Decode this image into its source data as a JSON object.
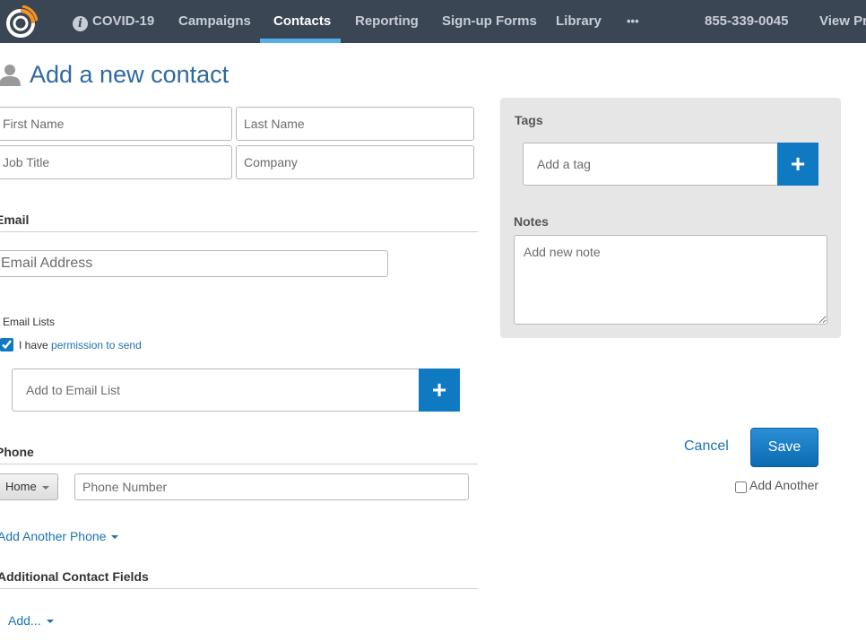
{
  "nav": {
    "items": [
      {
        "label": "COVID-19"
      },
      {
        "label": "Campaigns"
      },
      {
        "label": "Contacts"
      },
      {
        "label": "Reporting"
      },
      {
        "label": "Sign-up Forms"
      },
      {
        "label": "Library"
      },
      {
        "label": "•••"
      }
    ],
    "active": "Contacts",
    "phone": "855-339-0045",
    "view_link": "View Pri"
  },
  "page": {
    "title": "Add a new contact"
  },
  "form": {
    "first_name_placeholder": "First Name",
    "last_name_placeholder": "Last Name",
    "job_title_placeholder": "Job Title",
    "company_placeholder": "Company",
    "email_section": "Email",
    "email_placeholder": "Email Address",
    "email_lists_label": "Email Lists",
    "permission_prefix": "I have",
    "permission_link": "permission to send",
    "permission_checked": true,
    "email_list_placeholder": "Add to Email List",
    "phone_section": "Phone",
    "phone_type": "Home",
    "phone_placeholder": "Phone Number",
    "add_phone_link": "Add Another Phone",
    "additional_section": "Additional Contact Fields",
    "add_field_link": "Add..."
  },
  "sidebar": {
    "tags_label": "Tags",
    "tag_placeholder": "Add a tag",
    "notes_label": "Notes",
    "notes_placeholder": "Add new note"
  },
  "actions": {
    "cancel": "Cancel",
    "save": "Save",
    "add_another": "Add Another",
    "add_another_checked": false
  },
  "colors": {
    "topbar": "#3b4654",
    "accent": "#0f79c2",
    "title": "#2f6aa0",
    "underline": "#55aee6"
  }
}
